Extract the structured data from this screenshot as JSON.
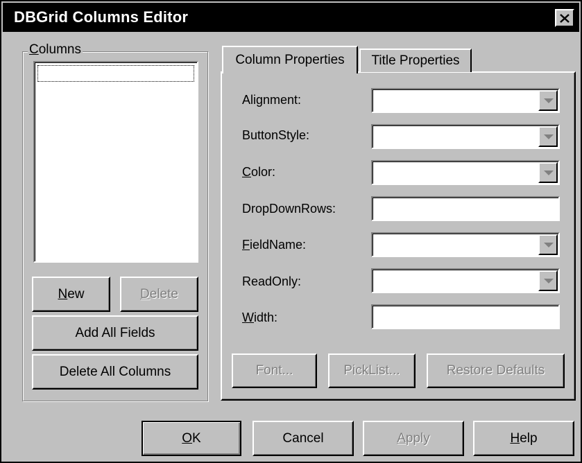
{
  "window": {
    "title": "DBGrid Columns Editor"
  },
  "columns_group": {
    "label_accel": "C",
    "label_rest": "olumns",
    "new_button": {
      "accel": "N",
      "rest": "ew"
    },
    "delete_button": {
      "accel": "D",
      "rest": "elete"
    },
    "add_all_fields_label": "Add All Fields",
    "delete_all_columns_label": "Delete All Columns"
  },
  "tabs": [
    {
      "label": "Column Properties",
      "active": true
    },
    {
      "label": "Title Properties",
      "active": false
    }
  ],
  "properties": {
    "alignment": {
      "label": "Alignment:",
      "value": ""
    },
    "button_style": {
      "label": "ButtonStyle:",
      "value": ""
    },
    "color": {
      "accel": "C",
      "rest": "olor:",
      "value": ""
    },
    "drop_down_rows": {
      "label": "DropDownRows:",
      "value": ""
    },
    "field_name": {
      "accel": "F",
      "rest": "ieldName:",
      "value": ""
    },
    "read_only": {
      "label": "ReadOnly:",
      "value": ""
    },
    "width": {
      "accel": "W",
      "rest": "idth:",
      "value": ""
    }
  },
  "panel_buttons": {
    "font": "Font...",
    "picklist": "PickList...",
    "restore_defaults": "Restore Defaults"
  },
  "dialog_buttons": {
    "ok": {
      "accel": "O",
      "rest": "K"
    },
    "cancel": "Cancel",
    "apply": {
      "accel": "A",
      "rest": "pply"
    },
    "help": {
      "accel": "H",
      "rest": "elp"
    }
  },
  "colors": {
    "face": "#c0c0c0",
    "title_bar": "#000000",
    "disabled_text": "#808080"
  },
  "icons": {
    "close": "close-icon",
    "dropdown": "chevron-down-icon"
  }
}
